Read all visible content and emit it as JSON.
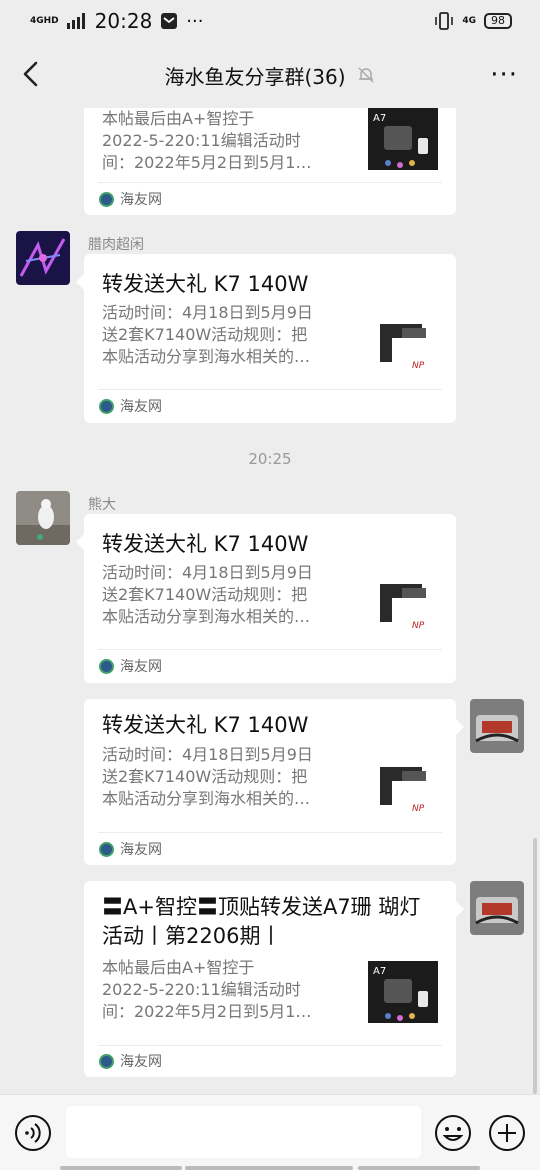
{
  "status_bar": {
    "network": "4GHD",
    "time": "20:28",
    "net_right": "4G",
    "battery": "98"
  },
  "header": {
    "title": "海水鱼友分享群(36)",
    "more": "···"
  },
  "messages": [
    {
      "title": "",
      "desc": [
        "本帖最后由A+智控于",
        "2022-5-220:11编辑活动时",
        "间：2022年5月2日到5月1…"
      ],
      "source": "海友网"
    },
    {
      "sender": "腊肉超闲",
      "title": "转发送大礼 K7 140W",
      "desc": [
        "活动时间：4月18日到5月9日",
        "送2套K7140W活动规则：把",
        "本贴活动分享到海水相关的…"
      ],
      "source": "海友网"
    },
    {
      "sender": "熊大",
      "title": "转发送大礼 K7 140W",
      "desc": [
        "活动时间：4月18日到5月9日",
        "送2套K7140W活动规则：把",
        "本贴活动分享到海水相关的…"
      ],
      "source": "海友网"
    },
    {
      "title": "转发送大礼 K7 140W",
      "desc": [
        "活动时间：4月18日到5月9日",
        "送2套K7140W活动规则：把",
        "本贴活动分享到海水相关的…"
      ],
      "source": "海友网"
    },
    {
      "title": "〓A+智控〓顶贴转发送A7珊 瑚灯活动丨第2206期丨",
      "desc": [
        "本帖最后由A+智控于",
        "2022-5-220:11编辑活动时",
        "间：2022年5月2日到5月1…"
      ],
      "source": "海友网"
    }
  ],
  "timestamp": "20:25",
  "thumb_labels": {
    "a7": "A7",
    "np": "NP"
  },
  "colors": {
    "background": "#ededed",
    "card": "#ffffff",
    "accent_source": "#2d5a8a"
  }
}
